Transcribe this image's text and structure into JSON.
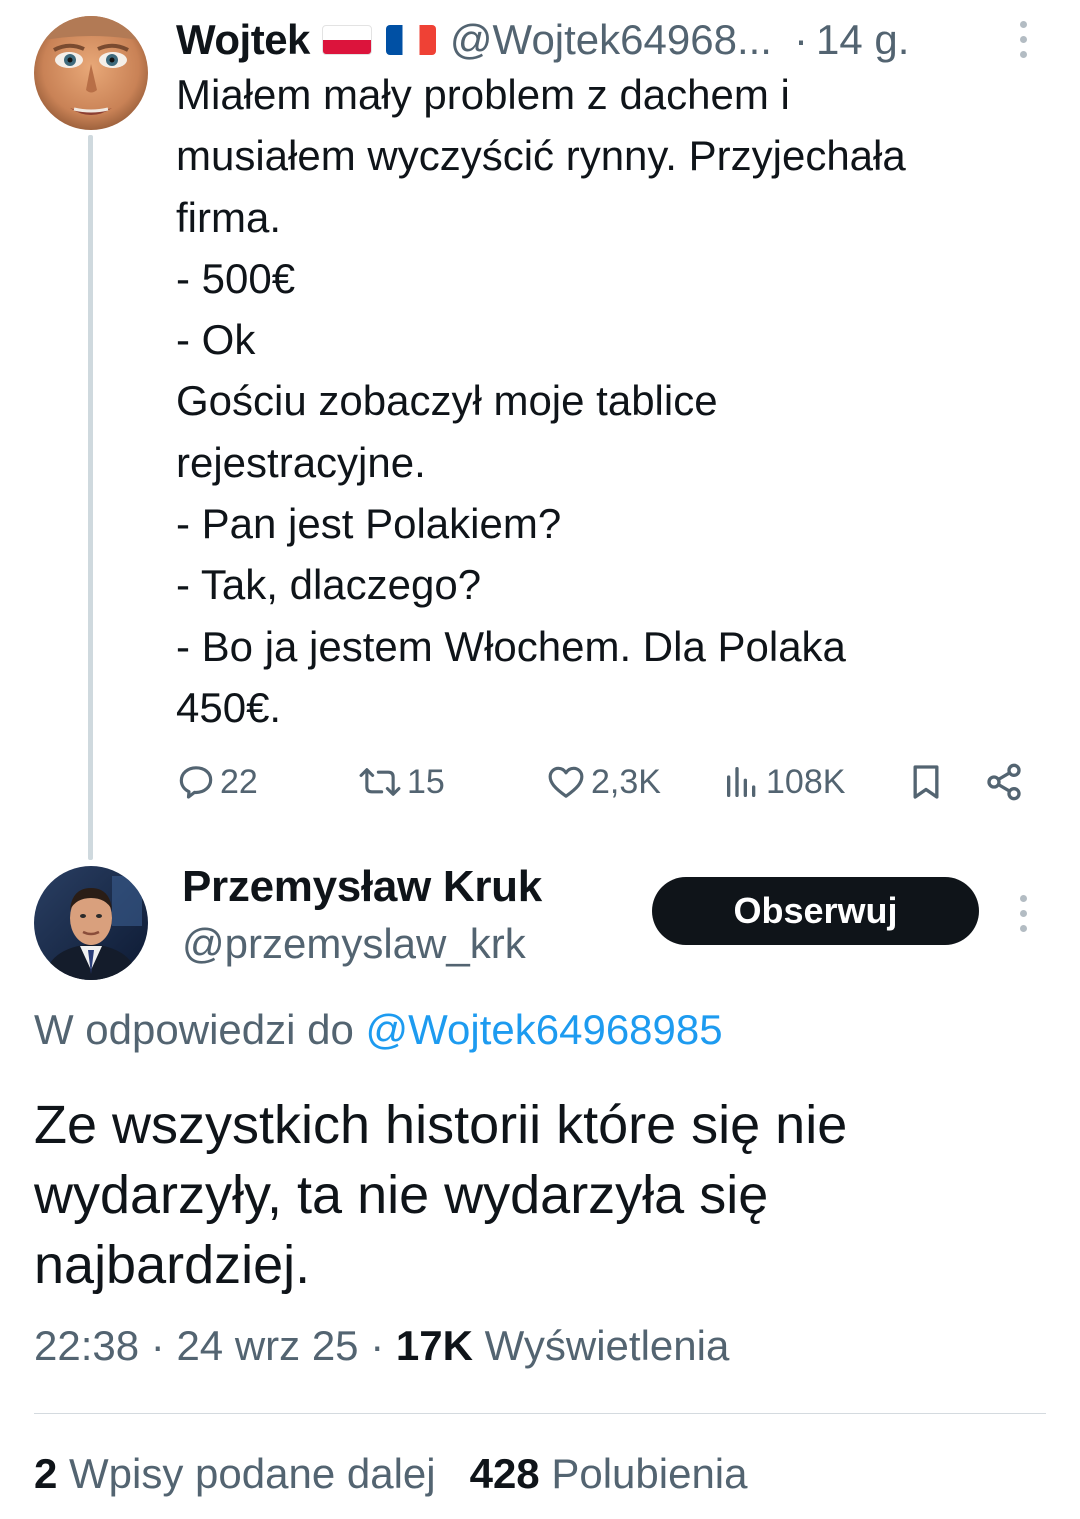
{
  "parent_tweet": {
    "author_name": "Wojtek",
    "flags": [
      "flag-poland-icon",
      "flag-france-icon"
    ],
    "handle": "@Wojtek64968...",
    "separator": "·",
    "time": "14 g.",
    "text": "Miałem mały problem z dachem i\nmusiałem wyczyścić rynny. Przyjechała\nfirma.\n- 500€\n- Ok\nGościu zobaczył moje tablice\nrejestracyjne.\n- Pan jest Polakiem?\n- Tak, dlaczego?\n- Bo ja jestem Włochem. Dla Polaka\n450€.",
    "actions": {
      "replies": "22",
      "reposts": "15",
      "likes": "2,3K",
      "views": "108K"
    }
  },
  "reply_tweet": {
    "author_name": "Przemysław Kruk",
    "handle": "@przemyslaw_krk",
    "follow_label": "Obserwuj",
    "reply_prefix": "W odpowiedzi do",
    "reply_mention": "@Wojtek64968985",
    "text": "Ze wszystkich historii które się nie wydarzyły, ta nie wydarzyła się najbardziej.",
    "time": "22:38",
    "date": "24 wrz 25",
    "views_count": "17K",
    "views_label": "Wyświetlenia",
    "reposts_count": "2",
    "reposts_label": "Wpisy podane dalej",
    "likes_count": "428",
    "likes_label": "Polubienia"
  },
  "colors": {
    "text": "#0f1419",
    "secondary": "#536471",
    "link": "#1d9bf0",
    "button_bg": "#0f1419"
  }
}
